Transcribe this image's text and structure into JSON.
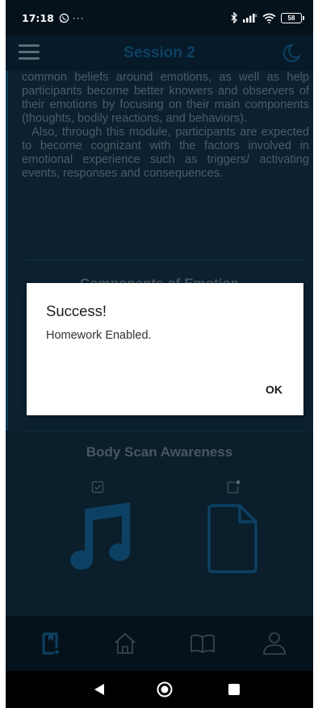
{
  "status_bar": {
    "time": "17:18",
    "notification_icons": [
      "whatsapp-icon",
      "more-dots-icon"
    ],
    "system_icons": [
      "bluetooth-icon",
      "signal-icon",
      "wifi-icon"
    ],
    "battery_level": "58"
  },
  "app_bar": {
    "title": "Session 2"
  },
  "content": {
    "paragraph_1": "common beliefs around emotions, as well as help participants become better knowers and observers of their emotions by focusing on their main components (thoughts, bodily reactions, and behaviors).",
    "paragraph_2": "Also, through this module, participants are expected to become cognizant with the factors involved in emotional experience such as triggers/ activating events, responses and consequences.",
    "section_1_title": "Components of Emotion",
    "section_2_title": "Body Scan Awareness",
    "section_2_items": [
      {
        "icon": "music-note-icon",
        "status_icon": "checkbox-icon"
      },
      {
        "icon": "document-icon",
        "status_icon": "add-file-icon"
      }
    ]
  },
  "bottom_nav": {
    "items": [
      {
        "icon": "homework-icon",
        "active": true
      },
      {
        "icon": "home-icon",
        "active": false
      },
      {
        "icon": "book-icon",
        "active": false
      },
      {
        "icon": "profile-icon",
        "active": false
      }
    ]
  },
  "dialog": {
    "title": "Success!",
    "message": "Homework Enabled.",
    "ok_label": "OK"
  },
  "colors": {
    "accent": "#0d4163",
    "background": "#0b2130",
    "dialog_background": "#ffffff"
  }
}
